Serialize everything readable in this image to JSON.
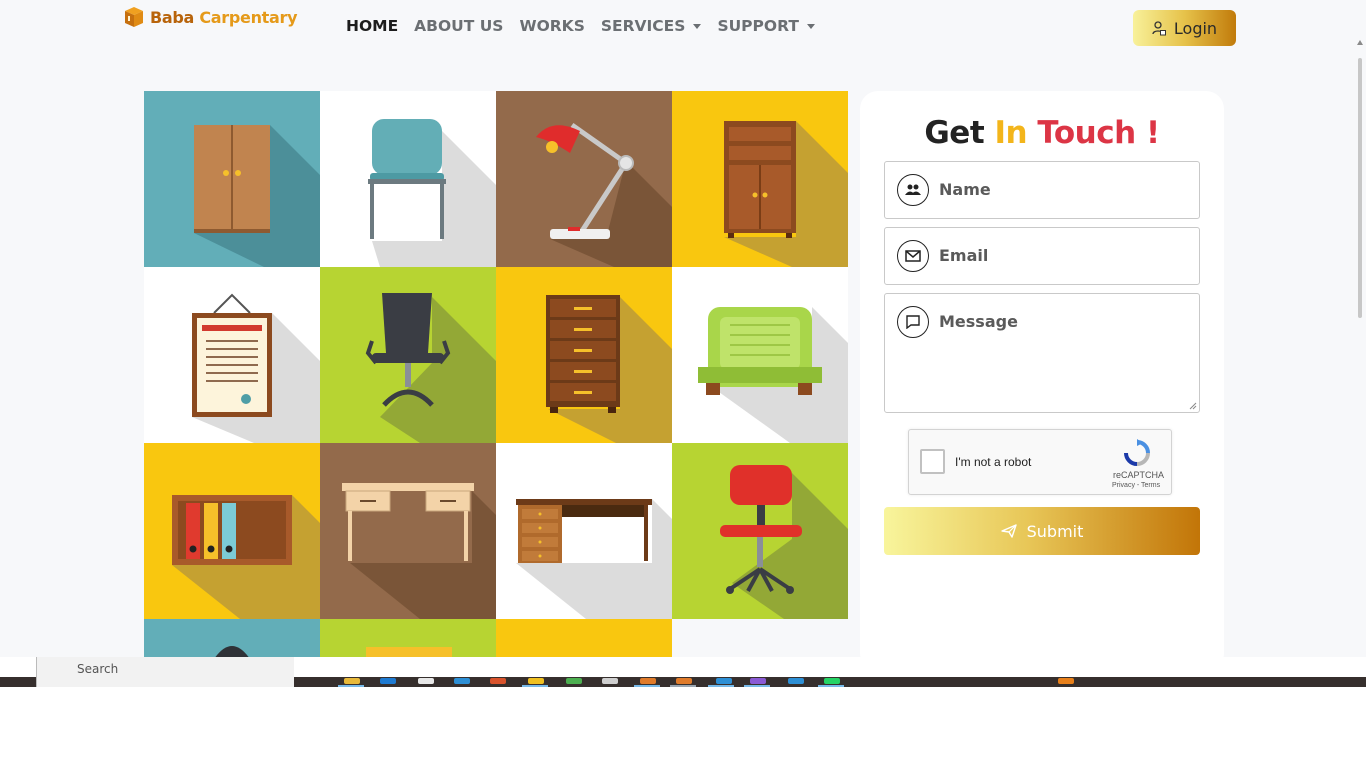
{
  "brand": {
    "word1": "Baba",
    "word2": "Carpentary",
    "logo_icon": "box-logo-icon"
  },
  "nav": {
    "items": [
      {
        "label": "HOME",
        "active": true,
        "dropdown": false
      },
      {
        "label": "ABOUT US",
        "active": false,
        "dropdown": false
      },
      {
        "label": "WORKS",
        "active": false,
        "dropdown": false
      },
      {
        "label": "SERVICES",
        "active": false,
        "dropdown": true
      },
      {
        "label": "SUPPORT",
        "active": false,
        "dropdown": true
      }
    ]
  },
  "login": {
    "label": "Login",
    "icon": "user-lock-icon"
  },
  "gallery": {
    "tiles": [
      {
        "name": "wardrobe",
        "bg": "#62aeb8"
      },
      {
        "name": "chair",
        "bg": "#ffffff"
      },
      {
        "name": "desk-lamp",
        "bg": "#936a4b"
      },
      {
        "name": "cabinet",
        "bg": "#f9c70f"
      },
      {
        "name": "certificate-frame",
        "bg": "#ffffff"
      },
      {
        "name": "office-chair",
        "bg": "#b7d432"
      },
      {
        "name": "drawer-chest",
        "bg": "#f9c70f"
      },
      {
        "name": "armchair",
        "bg": "#ffffff"
      },
      {
        "name": "file-shelf",
        "bg": "#f9c70f"
      },
      {
        "name": "wooden-desk",
        "bg": "#936a4b"
      },
      {
        "name": "office-desk",
        "bg": "#ffffff"
      },
      {
        "name": "red-office-chair",
        "bg": "#b7d432"
      },
      {
        "name": "partial-tile-1",
        "bg": "#62aeb8"
      },
      {
        "name": "partial-tile-2",
        "bg": "#b7d432"
      },
      {
        "name": "partial-tile-3",
        "bg": "#f9c70f"
      }
    ]
  },
  "contact": {
    "title": {
      "part1": "Get",
      "part2": "In",
      "part3": "Touch !"
    },
    "name_placeholder": "Name",
    "email_placeholder": "Email",
    "message_placeholder": "Message",
    "captcha": {
      "label": "I'm not a robot",
      "brand": "reCAPTCHA",
      "links": "Privacy - Terms"
    },
    "submit_label": "Submit"
  },
  "taskbar": {
    "search_text": "Search"
  },
  "colors": {
    "accent_gold": "#c17b0b",
    "accent_yellow": "#f3b51b",
    "accent_red": "#dc3545"
  }
}
